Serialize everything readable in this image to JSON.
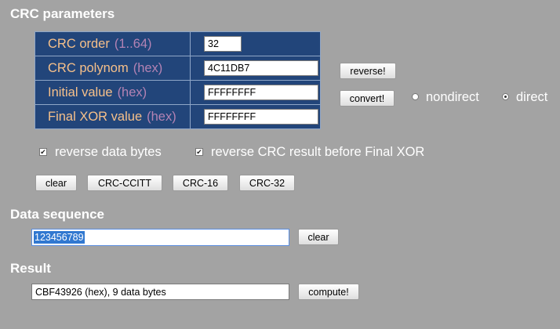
{
  "crc_parameters": {
    "title": "CRC parameters",
    "rows": [
      {
        "label": "CRC order",
        "hint": "(1..64)",
        "value": "32"
      },
      {
        "label": "CRC polynom",
        "hint": "(hex)",
        "value": "4C11DB7"
      },
      {
        "label": "Initial value",
        "hint": "(hex)",
        "value": "FFFFFFFF"
      },
      {
        "label": "Final XOR value",
        "hint": "(hex)",
        "value": "FFFFFFFF"
      }
    ],
    "reverse_button": "reverse!",
    "convert_button": "convert!",
    "mode_options": [
      {
        "label": "nondirect",
        "selected": false
      },
      {
        "label": "direct",
        "selected": true
      }
    ],
    "checkboxes": [
      {
        "label": "reverse data bytes",
        "checked": true
      },
      {
        "label": "reverse CRC result before Final XOR",
        "checked": true
      }
    ],
    "presets": [
      "clear",
      "CRC-CCITT",
      "CRC-16",
      "CRC-32"
    ]
  },
  "data_sequence": {
    "title": "Data sequence",
    "value": "123456789",
    "clear_button": "clear"
  },
  "result": {
    "title": "Result",
    "value": "CBF43926 (hex), 9 data bytes",
    "compute_button": "compute!"
  },
  "colors": {
    "background": "#a3a3a3",
    "table_background": "#22457a",
    "label_text": "#f6c08a",
    "hint_text": "#b483b4",
    "selection": "#3178d0"
  }
}
